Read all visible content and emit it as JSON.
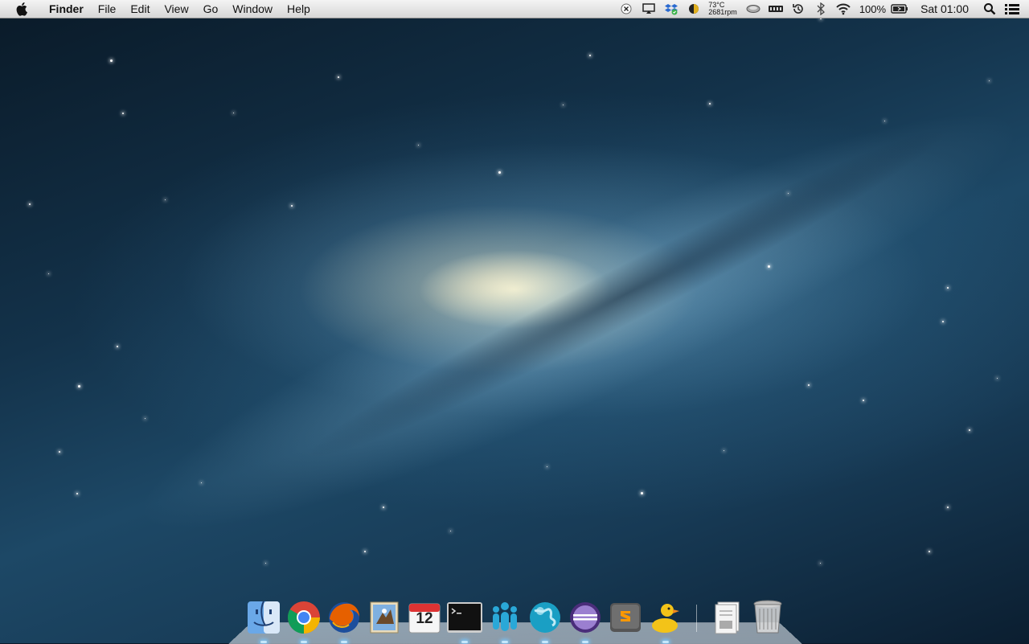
{
  "menubar": {
    "apple_icon": "apple-logo",
    "app_name": "Finder",
    "menus": [
      "File",
      "Edit",
      "View",
      "Go",
      "Window",
      "Help"
    ],
    "status": {
      "temperature": "73°C",
      "fan_speed": "2681rpm",
      "battery_percent": "100%",
      "clock": "Sat 01:00"
    },
    "status_icons": [
      "close-x-icon",
      "airplay-icon",
      "dropbox-icon",
      "nightlight-icon",
      "drive-icon",
      "memory-icon",
      "time-machine-icon",
      "bluetooth-icon",
      "wifi-icon",
      "battery-icon",
      "spotlight-icon",
      "notification-center-icon"
    ]
  },
  "dock": {
    "apps": [
      {
        "name": "Finder",
        "icon": "finder-icon",
        "running": true
      },
      {
        "name": "Google Chrome",
        "icon": "chrome-icon",
        "running": true
      },
      {
        "name": "Firefox",
        "icon": "firefox-icon",
        "running": true
      },
      {
        "name": "Mail",
        "icon": "mail-icon",
        "running": false
      },
      {
        "name": "Calendar",
        "icon": "calendar-icon",
        "running": false,
        "date_number": "12"
      },
      {
        "name": "Terminal",
        "icon": "terminal-icon",
        "running": true
      },
      {
        "name": "Messaging",
        "icon": "messaging-icon",
        "running": true
      },
      {
        "name": "Network Browser",
        "icon": "globe-icon",
        "running": true
      },
      {
        "name": "Eclipse",
        "icon": "eclipse-icon",
        "running": true
      },
      {
        "name": "Sublime Text",
        "icon": "sublime-icon",
        "running": false
      },
      {
        "name": "Cyberduck",
        "icon": "duck-icon",
        "running": true
      }
    ],
    "documents_icon": "documents-stack-icon",
    "trash_icon": "trash-icon"
  }
}
